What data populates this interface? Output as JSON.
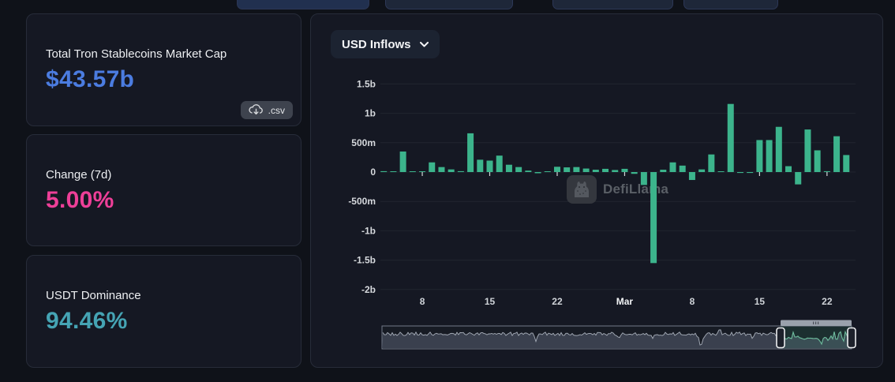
{
  "colors": {
    "background": "#0f1219",
    "panel": "#151823",
    "accent_blue": "#4b7ce0",
    "accent_pink": "#ee3f98",
    "accent_teal": "#45a4b4",
    "bar_green": "#3cb48c"
  },
  "cards": [
    {
      "title": "Total Tron Stablecoins Market Cap",
      "value": "$43.57b",
      "value_color": "#4b7ce0",
      "download_label": ".csv"
    },
    {
      "title": "Change (7d)",
      "value": "5.00%",
      "value_color": "#ee3f98"
    },
    {
      "title": "USDT Dominance",
      "value": "94.46%",
      "value_color": "#45a4b4"
    }
  ],
  "chart_panel": {
    "range_selector_label": "USD Inflows",
    "watermark_text": "DefiLlama"
  },
  "chart_data": {
    "type": "bar",
    "title": "USD Inflows",
    "unit": "USD",
    "bar_color": "#3cb48c",
    "grid": "horizontal",
    "ylim_m": [
      -2000,
      1500
    ],
    "y_ticks": [
      {
        "label": "1.5b",
        "value_m": 1500
      },
      {
        "label": "1b",
        "value_m": 1000
      },
      {
        "label": "500m",
        "value_m": 500
      },
      {
        "label": "0",
        "value_m": 0
      },
      {
        "label": "-500m",
        "value_m": -500
      },
      {
        "label": "-1b",
        "value_m": -1000
      },
      {
        "label": "-1.5b",
        "value_m": -1500
      },
      {
        "label": "-2b",
        "value_m": -2000
      }
    ],
    "x_ticks": [
      {
        "index": 4,
        "label": "8"
      },
      {
        "index": 11,
        "label": "15"
      },
      {
        "index": 18,
        "label": "22"
      },
      {
        "index": 25,
        "label": "Mar",
        "bold": true
      },
      {
        "index": 32,
        "label": "8"
      },
      {
        "index": 39,
        "label": "15"
      },
      {
        "index": 46,
        "label": "22"
      }
    ],
    "categories": [
      "Feb 4",
      "Feb 5",
      "Feb 6",
      "Feb 7",
      "Feb 8",
      "Feb 9",
      "Feb 10",
      "Feb 11",
      "Feb 12",
      "Feb 13",
      "Feb 14",
      "Feb 15",
      "Feb 16",
      "Feb 17",
      "Feb 18",
      "Feb 19",
      "Feb 20",
      "Feb 21",
      "Feb 22",
      "Feb 23",
      "Feb 24",
      "Feb 25",
      "Feb 26",
      "Feb 27",
      "Feb 28",
      "Mar 1",
      "Mar 2",
      "Mar 3",
      "Mar 4",
      "Mar 5",
      "Mar 6",
      "Mar 7",
      "Mar 8",
      "Mar 9",
      "Mar 10",
      "Mar 11",
      "Mar 12",
      "Mar 13",
      "Mar 14",
      "Mar 15",
      "Mar 16",
      "Mar 17",
      "Mar 18",
      "Mar 19",
      "Mar 20",
      "Mar 21",
      "Mar 22",
      "Mar 23",
      "Mar 24"
    ],
    "values_millions": [
      15,
      8,
      350,
      6,
      5,
      165,
      85,
      45,
      15,
      660,
      210,
      195,
      280,
      125,
      85,
      25,
      -20,
      10,
      90,
      80,
      85,
      60,
      40,
      55,
      35,
      55,
      -30,
      -220,
      -1550,
      40,
      165,
      110,
      -135,
      45,
      300,
      10,
      1160,
      -15,
      -15,
      545,
      545,
      770,
      100,
      -210,
      725,
      370,
      15,
      610,
      290
    ],
    "legend": [],
    "brush": {
      "selection_start_frac": 0.849,
      "selection_end_frac": 1.0
    }
  }
}
